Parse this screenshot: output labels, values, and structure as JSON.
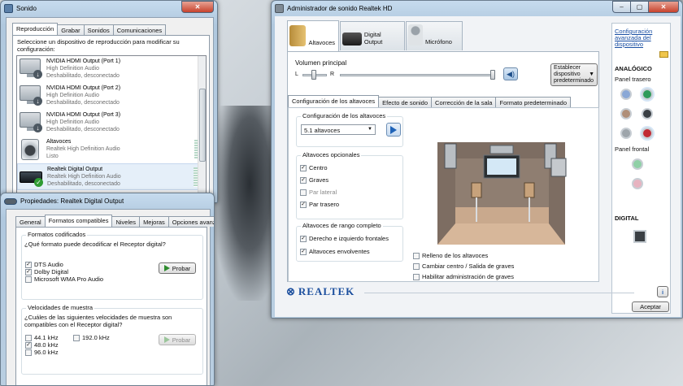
{
  "sound_window": {
    "title": "Sonido",
    "tabs": [
      "Reproducción",
      "Grabar",
      "Sonidos",
      "Comunicaciones"
    ],
    "instructions": "Seleccione un dispositivo de reproducción para modificar su configuración:",
    "devices": [
      {
        "name": "NVIDIA HDMI Output (Port 1)",
        "driver": "High Definition Audio",
        "status": "Deshabilitado, desconectado"
      },
      {
        "name": "NVIDIA HDMI Output (Port 2)",
        "driver": "High Definition Audio",
        "status": "Deshabilitado, desconectado"
      },
      {
        "name": "NVIDIA HDMI Output (Port 3)",
        "driver": "High Definition Audio",
        "status": "Deshabilitado, desconectado"
      },
      {
        "name": "Altavoces",
        "driver": "Realtek High Definition Audio",
        "status": "Listo"
      },
      {
        "name": "Realtek Digital Output",
        "driver": "Realtek High Definition Audio",
        "status": "Deshabilitado, desconectado"
      }
    ]
  },
  "props_window": {
    "title": "Propiedades: Realtek Digital Output",
    "tabs": [
      "General",
      "Formatos compatibles",
      "Niveles",
      "Mejoras",
      "Opciones avanzadas"
    ],
    "encoded_group": "Formatos codificados",
    "encoded_question": "¿Qué formato puede decodificar el Receptor digital?",
    "formats": [
      {
        "label": "DTS Audio",
        "checked": "✓"
      },
      {
        "label": "Dolby Digital",
        "checked": "✓"
      },
      {
        "label": "Microsoft WMA Pro Audio",
        "checked": ""
      }
    ],
    "test_button": "Probar",
    "rates_group": "Velocidades de muestra",
    "rates_question": "¿Cuáles de las siguientes velocidades de muestra son compatibles con el Receptor digital?",
    "rates": [
      {
        "label": "44.1 kHz",
        "checked": ""
      },
      {
        "label": "48.0 kHz",
        "checked": "✓"
      },
      {
        "label": "96.0 kHz",
        "checked": ""
      },
      {
        "label": "192.0 kHz",
        "checked": ""
      }
    ],
    "test_button_2": "Probar"
  },
  "realtek": {
    "title": "Administrador de sonido Realtek HD",
    "top_tabs": [
      "Altavoces",
      "Digital Output",
      "Micrófono"
    ],
    "volume_label": "Volumen principal",
    "left": "L",
    "right": "R",
    "default_device_btn": "Establecer dispositivo predeterminado",
    "sub_tabs": [
      "Configuración de los altavoces",
      "Efecto de sonido",
      "Corrección de la sala",
      "Formato predeterminado"
    ],
    "config_label": "Configuración de los altavoces",
    "config_value": "5.1 altavoces",
    "optional_label": "Altavoces opcionales",
    "optional": [
      {
        "label": "Centro",
        "checked": "✓"
      },
      {
        "label": "Graves",
        "checked": "✓"
      },
      {
        "label": "Par lateral",
        "checked": ""
      },
      {
        "label": "Par trasero",
        "checked": "✓"
      }
    ],
    "fullrange_label": "Altavoces de rango completo",
    "fullrange": [
      {
        "label": "Derecho e izquierdo frontales",
        "checked": "✓"
      },
      {
        "label": "Altavoces envolventes",
        "checked": "✓"
      }
    ],
    "room_options": [
      {
        "label": "Relleno de los altavoces",
        "checked": ""
      },
      {
        "label": "Cambiar centro / Salida de graves",
        "checked": ""
      },
      {
        "label": "Habilitar administración de graves",
        "checked": ""
      }
    ],
    "advanced_link": "Configuración avanzada del dispositivo",
    "analog": "ANALÓGICO",
    "rear_panel": "Panel trasero",
    "front_panel": "Panel frontal",
    "digital": "DIGITAL",
    "brand": "REALTEK",
    "accept": "Aceptar",
    "info_icon": "i"
  }
}
